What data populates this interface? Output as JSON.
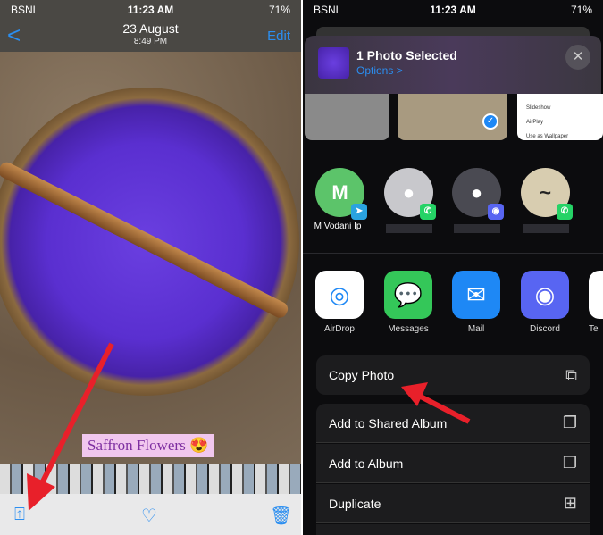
{
  "status": {
    "carrier": "BSNL",
    "time": "11:23 AM",
    "battery": "71%"
  },
  "photos": {
    "back_label": "<",
    "title": "23 August",
    "subtitle": "8:49 PM",
    "edit_label": "Edit",
    "caption": "Saffron Flowers 😍",
    "toolbar": {
      "share_icon": "share-icon",
      "favorite_icon": "heart-icon",
      "delete_icon": "trash-icon"
    }
  },
  "share_sheet": {
    "title": "1 Photo Selected",
    "options_label": "Options >",
    "preview_menu": [
      "Slideshow",
      "AirPlay",
      "Use as Wallpaper"
    ],
    "contacts": [
      {
        "name": "M Vodani Ip",
        "initial": "M",
        "app": "telegram"
      },
      {
        "name": "",
        "app": "whatsapp"
      },
      {
        "name": "",
        "app": "discord"
      },
      {
        "name": "",
        "app": "whatsapp"
      }
    ],
    "apps": [
      {
        "label": "AirDrop",
        "color": "#ffffff"
      },
      {
        "label": "Messages",
        "color": "#34c759"
      },
      {
        "label": "Mail",
        "color": "#1e88f5"
      },
      {
        "label": "Discord",
        "color": "#5865f2"
      },
      {
        "label": "Te",
        "color": "#ffffff"
      }
    ],
    "actions": [
      {
        "label": "Copy Photo",
        "icon": "copy-icon"
      },
      {
        "label": "Add to Shared Album",
        "icon": "shared-album-icon"
      },
      {
        "label": "Add to Album",
        "icon": "add-album-icon"
      },
      {
        "label": "Duplicate",
        "icon": "duplicate-icon"
      }
    ]
  },
  "colors": {
    "accent": "#2b8ef0",
    "arrow": "#e8202a"
  }
}
